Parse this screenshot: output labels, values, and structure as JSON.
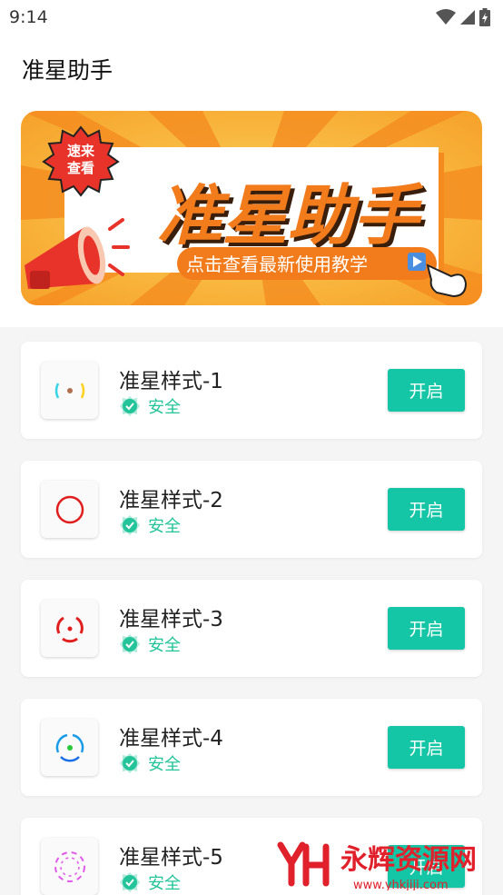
{
  "status_bar": {
    "time": "9:14"
  },
  "app": {
    "title": "准星助手"
  },
  "banner": {
    "badge_line1": "速来",
    "badge_line2": "查看",
    "headline": "准星助手",
    "subtitle": "点击查看最新使用教学"
  },
  "items": [
    {
      "name": "准星样式-1",
      "badge": "安全",
      "button": "开启"
    },
    {
      "name": "准星样式-2",
      "badge": "安全",
      "button": "开启"
    },
    {
      "name": "准星样式-3",
      "badge": "安全",
      "button": "开启"
    },
    {
      "name": "准星样式-4",
      "badge": "安全",
      "button": "开启"
    },
    {
      "name": "准星样式-5",
      "badge": "安全",
      "button": "开启"
    }
  ],
  "watermark": {
    "brand": "永辉资源网",
    "url": "www.yhkjiji.com"
  },
  "colors": {
    "accent": "#15c6a6",
    "safe_green": "#23c49a",
    "banner_orange": "#f58a1f",
    "banner_yellow": "#f9c23c"
  }
}
